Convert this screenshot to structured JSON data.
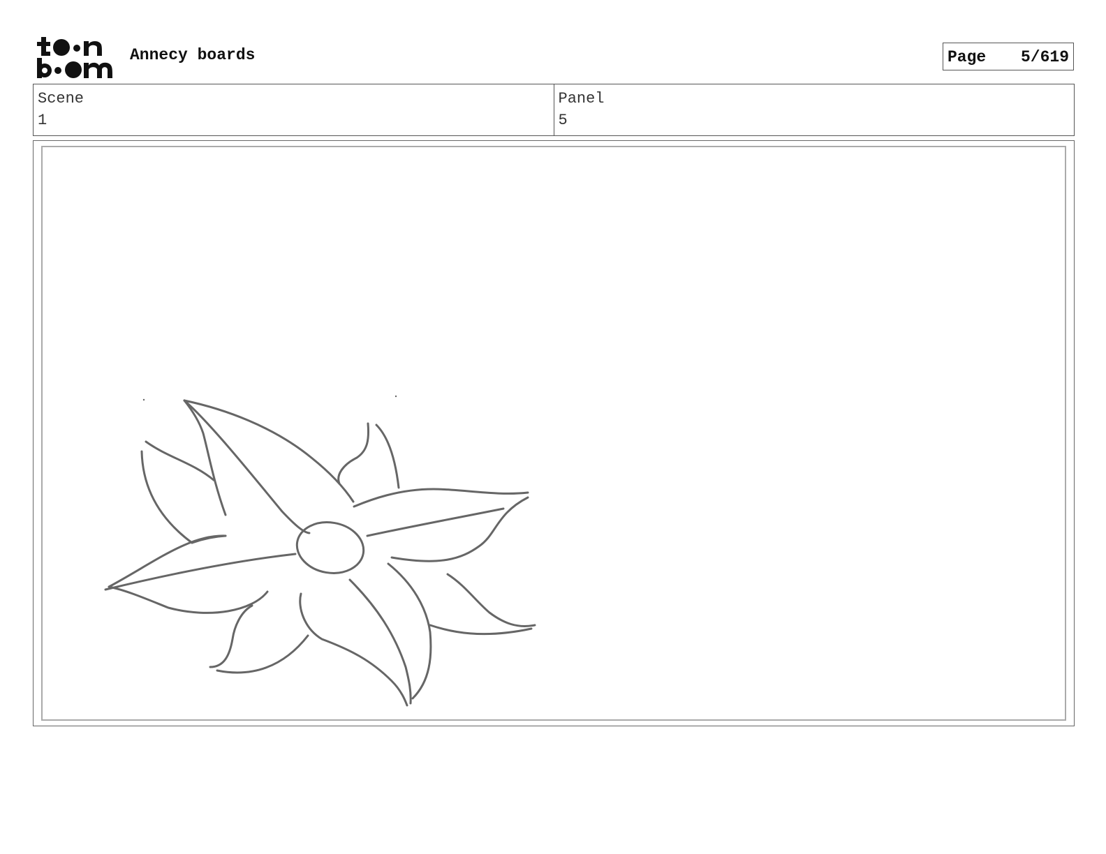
{
  "header": {
    "logo": {
      "text_line1": "toon",
      "text_line2": "boom",
      "icon": "toon-boom-logo"
    },
    "project_title": "Annecy boards",
    "page": {
      "label": "Page",
      "number": "5/619"
    }
  },
  "info": {
    "scene": {
      "label": "Scene",
      "value": "1"
    },
    "panel": {
      "label": "Panel",
      "value": "5"
    }
  },
  "panel_drawing": {
    "subject": "flower-sketch",
    "stroke_color": "#666666"
  }
}
